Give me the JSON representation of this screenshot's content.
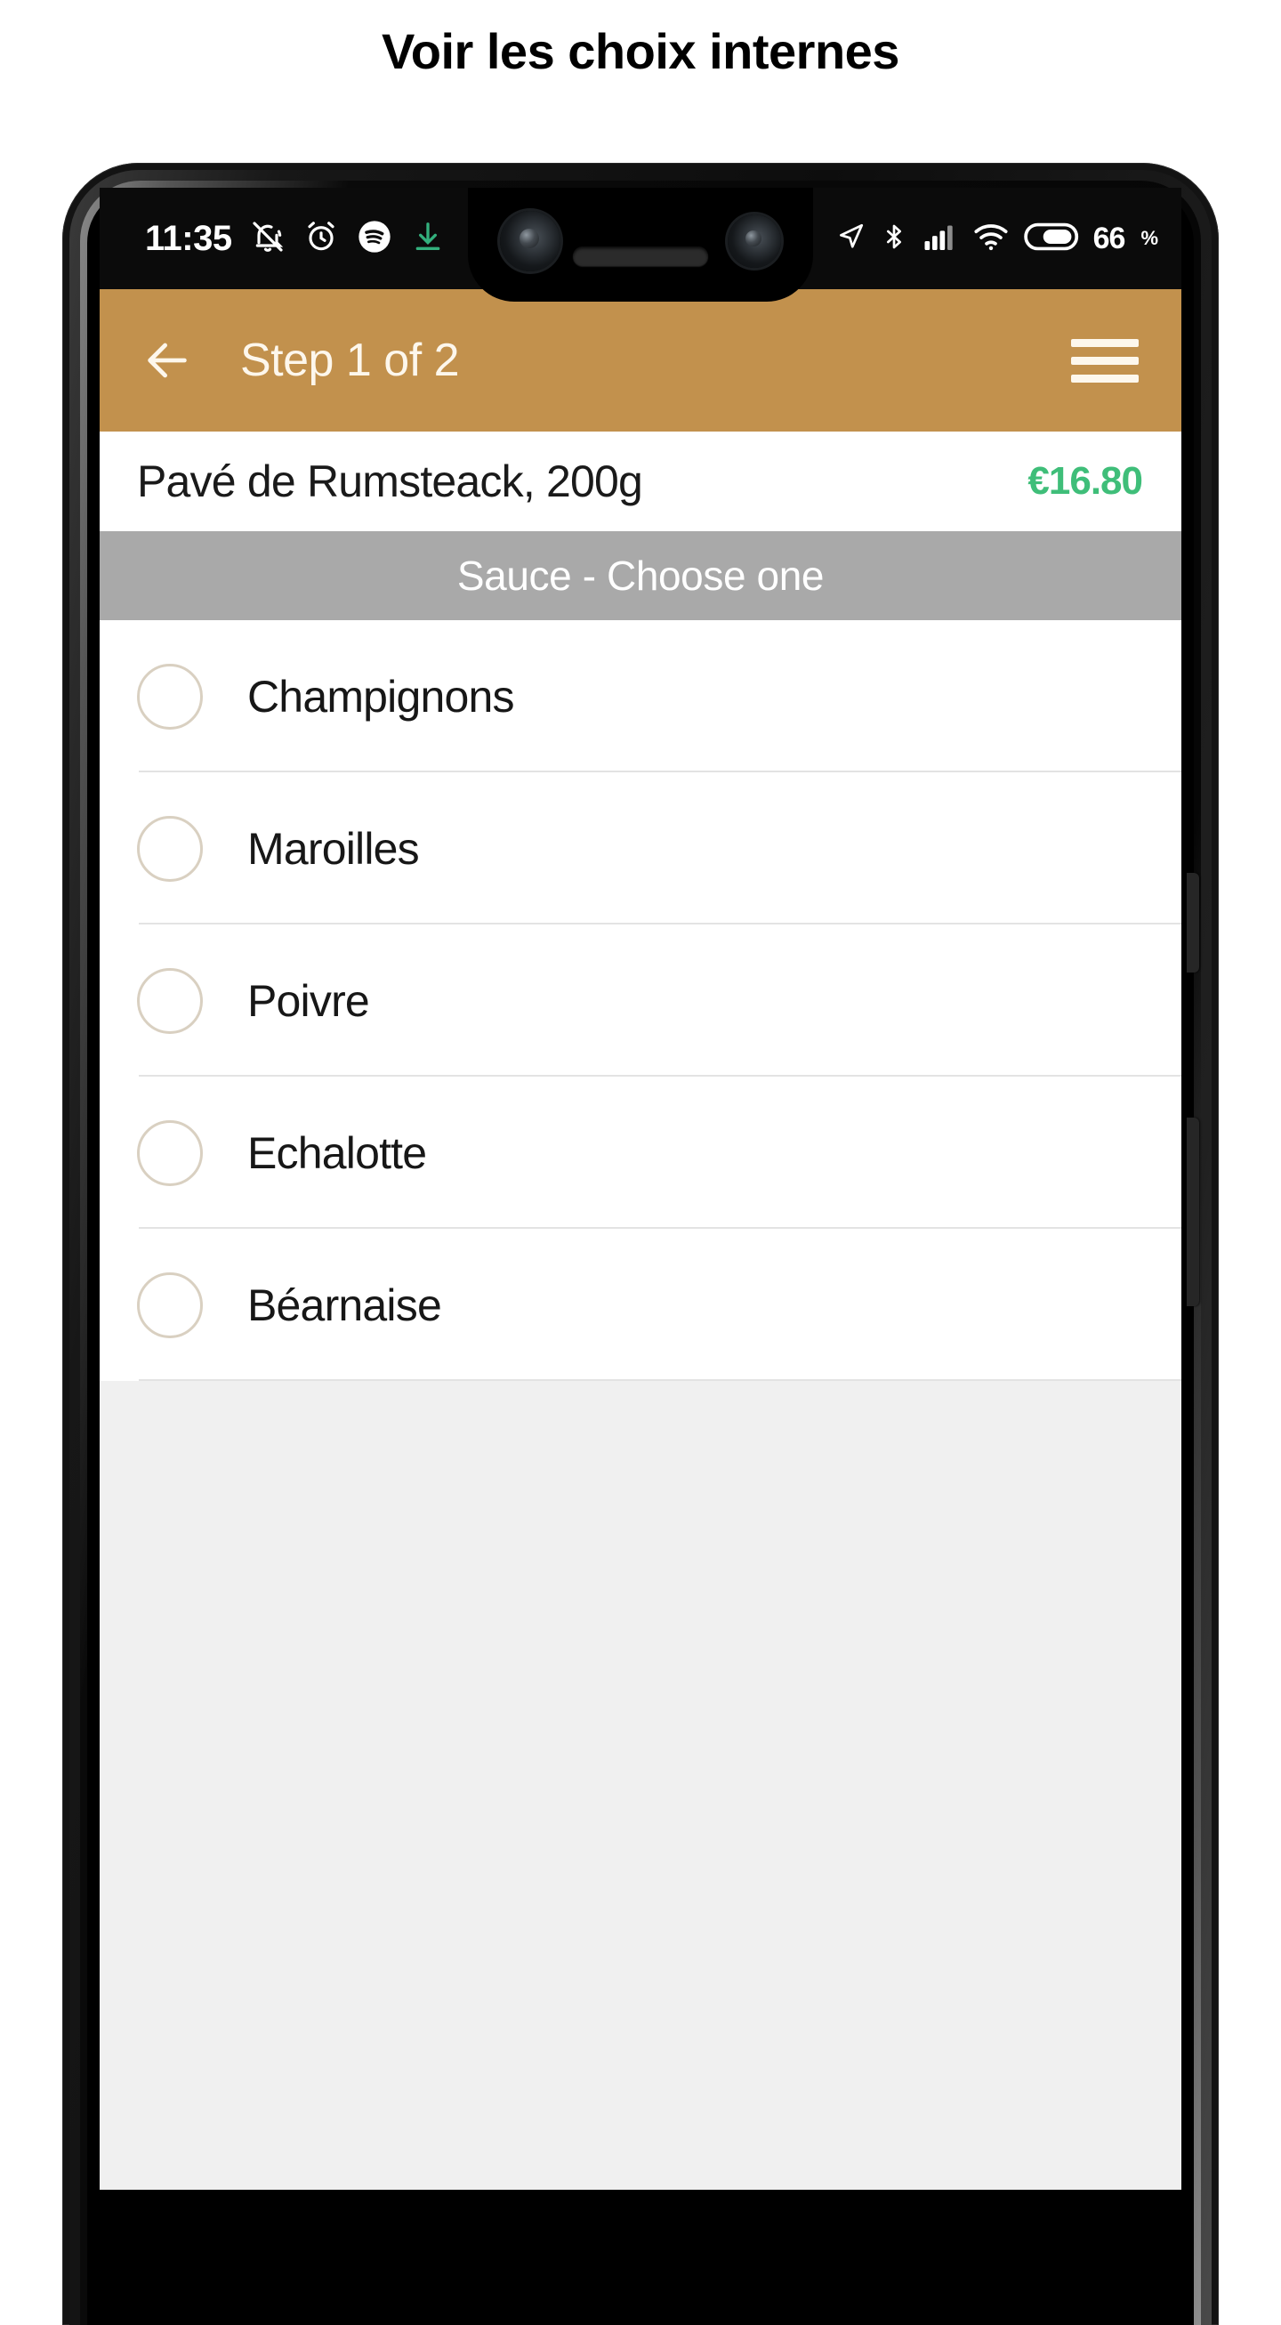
{
  "page": {
    "title": "Voir les choix internes"
  },
  "colors": {
    "app_bar": "#c2914d",
    "price_green": "#3fbe79",
    "section_header_gray": "#a9a9a9",
    "content_background": "#f0f0f0",
    "radio_outline": "#d9d0c1"
  },
  "status_bar": {
    "time": "11:35",
    "battery_percent": "66",
    "percent_symbol": "%",
    "left_icons": [
      "mute-bell-icon",
      "alarm-clock-icon",
      "spotify-icon",
      "download-arrow-icon"
    ],
    "right_icons": [
      "location-arrow-icon",
      "bluetooth-icon",
      "cellular-signal-icon",
      "wifi-icon",
      "battery-icon"
    ]
  },
  "app_bar": {
    "back_label": "back-arrow",
    "title": "Step 1 of 2",
    "menu_label": "hamburger-menu"
  },
  "product": {
    "name": "Pavé de Rumsteack, 200g",
    "price": "€16.80"
  },
  "section": {
    "header": "Sauce - Choose one"
  },
  "options": [
    {
      "label": "Champignons",
      "selected": false
    },
    {
      "label": "Maroilles",
      "selected": false
    },
    {
      "label": "Poivre",
      "selected": false
    },
    {
      "label": "Echalotte",
      "selected": false
    },
    {
      "label": "Béarnaise",
      "selected": false
    }
  ]
}
